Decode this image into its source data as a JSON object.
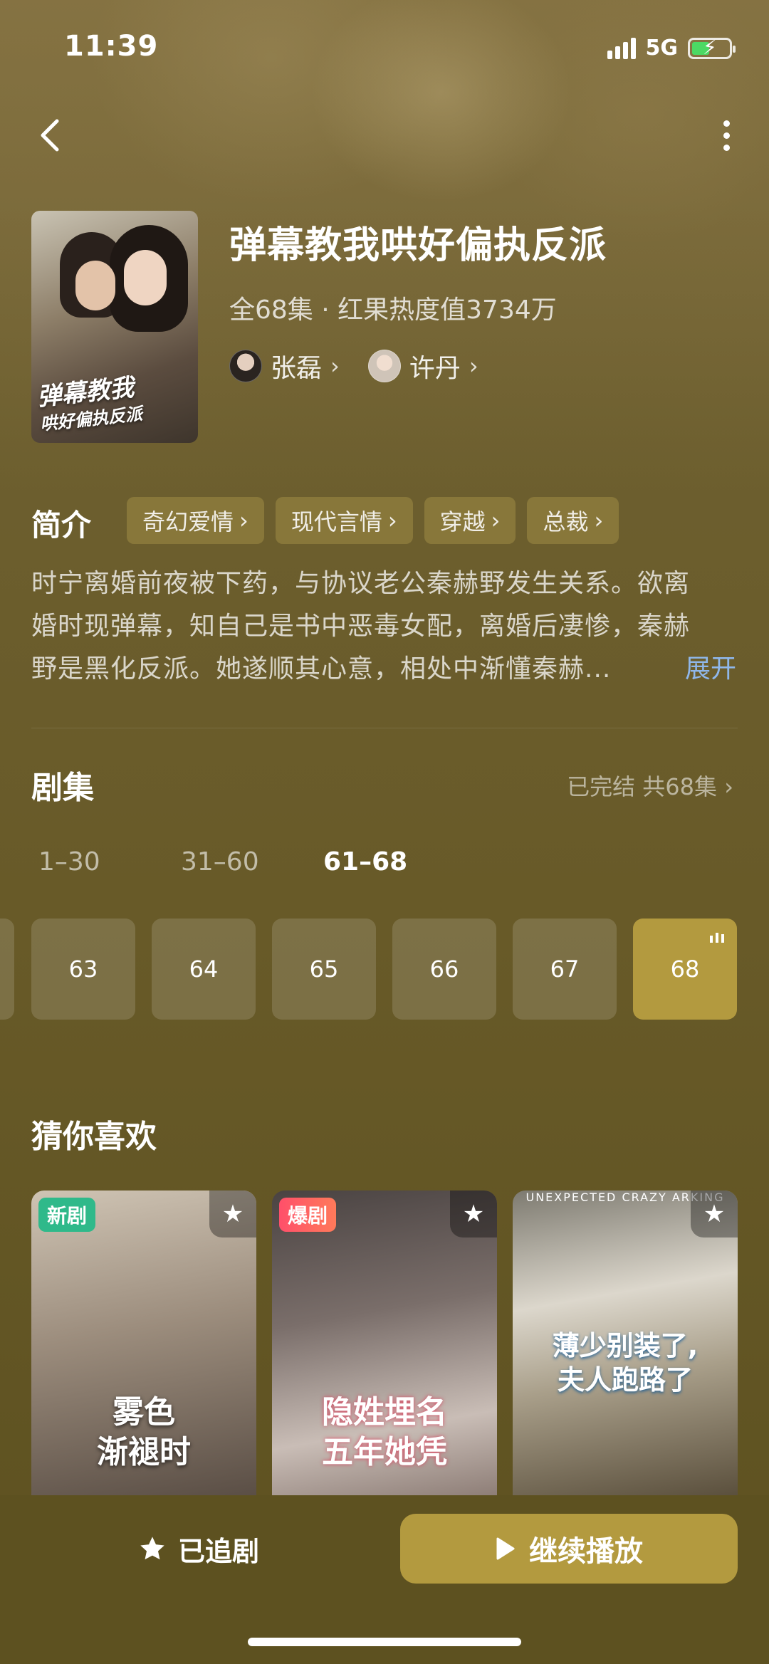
{
  "status_bar": {
    "time": "11:39",
    "network": "5G"
  },
  "drama": {
    "title": "弹幕教我哄好偏执反派",
    "meta": "全68集 · 红果热度值3734万",
    "poster_title_line1": "弹幕教我",
    "poster_title_line2": "哄好偏执反派",
    "actors": [
      {
        "name": "张磊",
        "chevron": "›"
      },
      {
        "name": "许丹",
        "chevron": "›"
      }
    ]
  },
  "intro": {
    "heading": "简介",
    "tags": [
      {
        "label": "奇幻爱情",
        "chevron": "›"
      },
      {
        "label": "现代言情",
        "chevron": "›"
      },
      {
        "label": "穿越",
        "chevron": "›"
      },
      {
        "label": "总裁",
        "chevron": "›"
      }
    ],
    "text_line1": "时宁离婚前夜被下药，与协议老公秦赫野发生关系。欲离",
    "text_line2": "婚时现弹幕，知自己是书中恶毒女配，离婚后凄惨，秦赫",
    "text_line3": "野是黑化反派。她遂顺其心意，相处中渐懂秦赫...",
    "expand_label": "展开"
  },
  "episodes": {
    "heading": "剧集",
    "summary": "已完结 共68集 ›",
    "ranges": [
      {
        "label": "1–30"
      },
      {
        "label": "31–60"
      },
      {
        "label": "61–68",
        "active": true
      }
    ],
    "items": [
      {
        "label": "63"
      },
      {
        "label": "64"
      },
      {
        "label": "65"
      },
      {
        "label": "66"
      },
      {
        "label": "67"
      },
      {
        "label": "68",
        "playing": true
      }
    ]
  },
  "recommend": {
    "heading": "猜你喜欢",
    "cards": [
      {
        "badge": "新剧",
        "title_line1": "雾色",
        "title_line2": "渐褪时",
        "caption": "",
        "fav_icon": "star-icon"
      },
      {
        "badge": "爆剧",
        "title_line1": "隐姓埋名",
        "title_line2": "五年她凭",
        "caption": "",
        "fav_icon": "star-icon"
      },
      {
        "badge": "",
        "title_line1": "薄少别装了,",
        "title_line2": "夫人跑路了",
        "caption": "UNEXPECTED CRAZY ARKING",
        "fav_icon": "star-icon"
      }
    ]
  },
  "bottom": {
    "follow_label": "已追剧",
    "play_label": "继续播放"
  },
  "colors": {
    "accent": "#b39a3f",
    "link": "#8fb7ea",
    "new_badge": "#2fb98a",
    "hot_badge": "#ff4f6a"
  }
}
